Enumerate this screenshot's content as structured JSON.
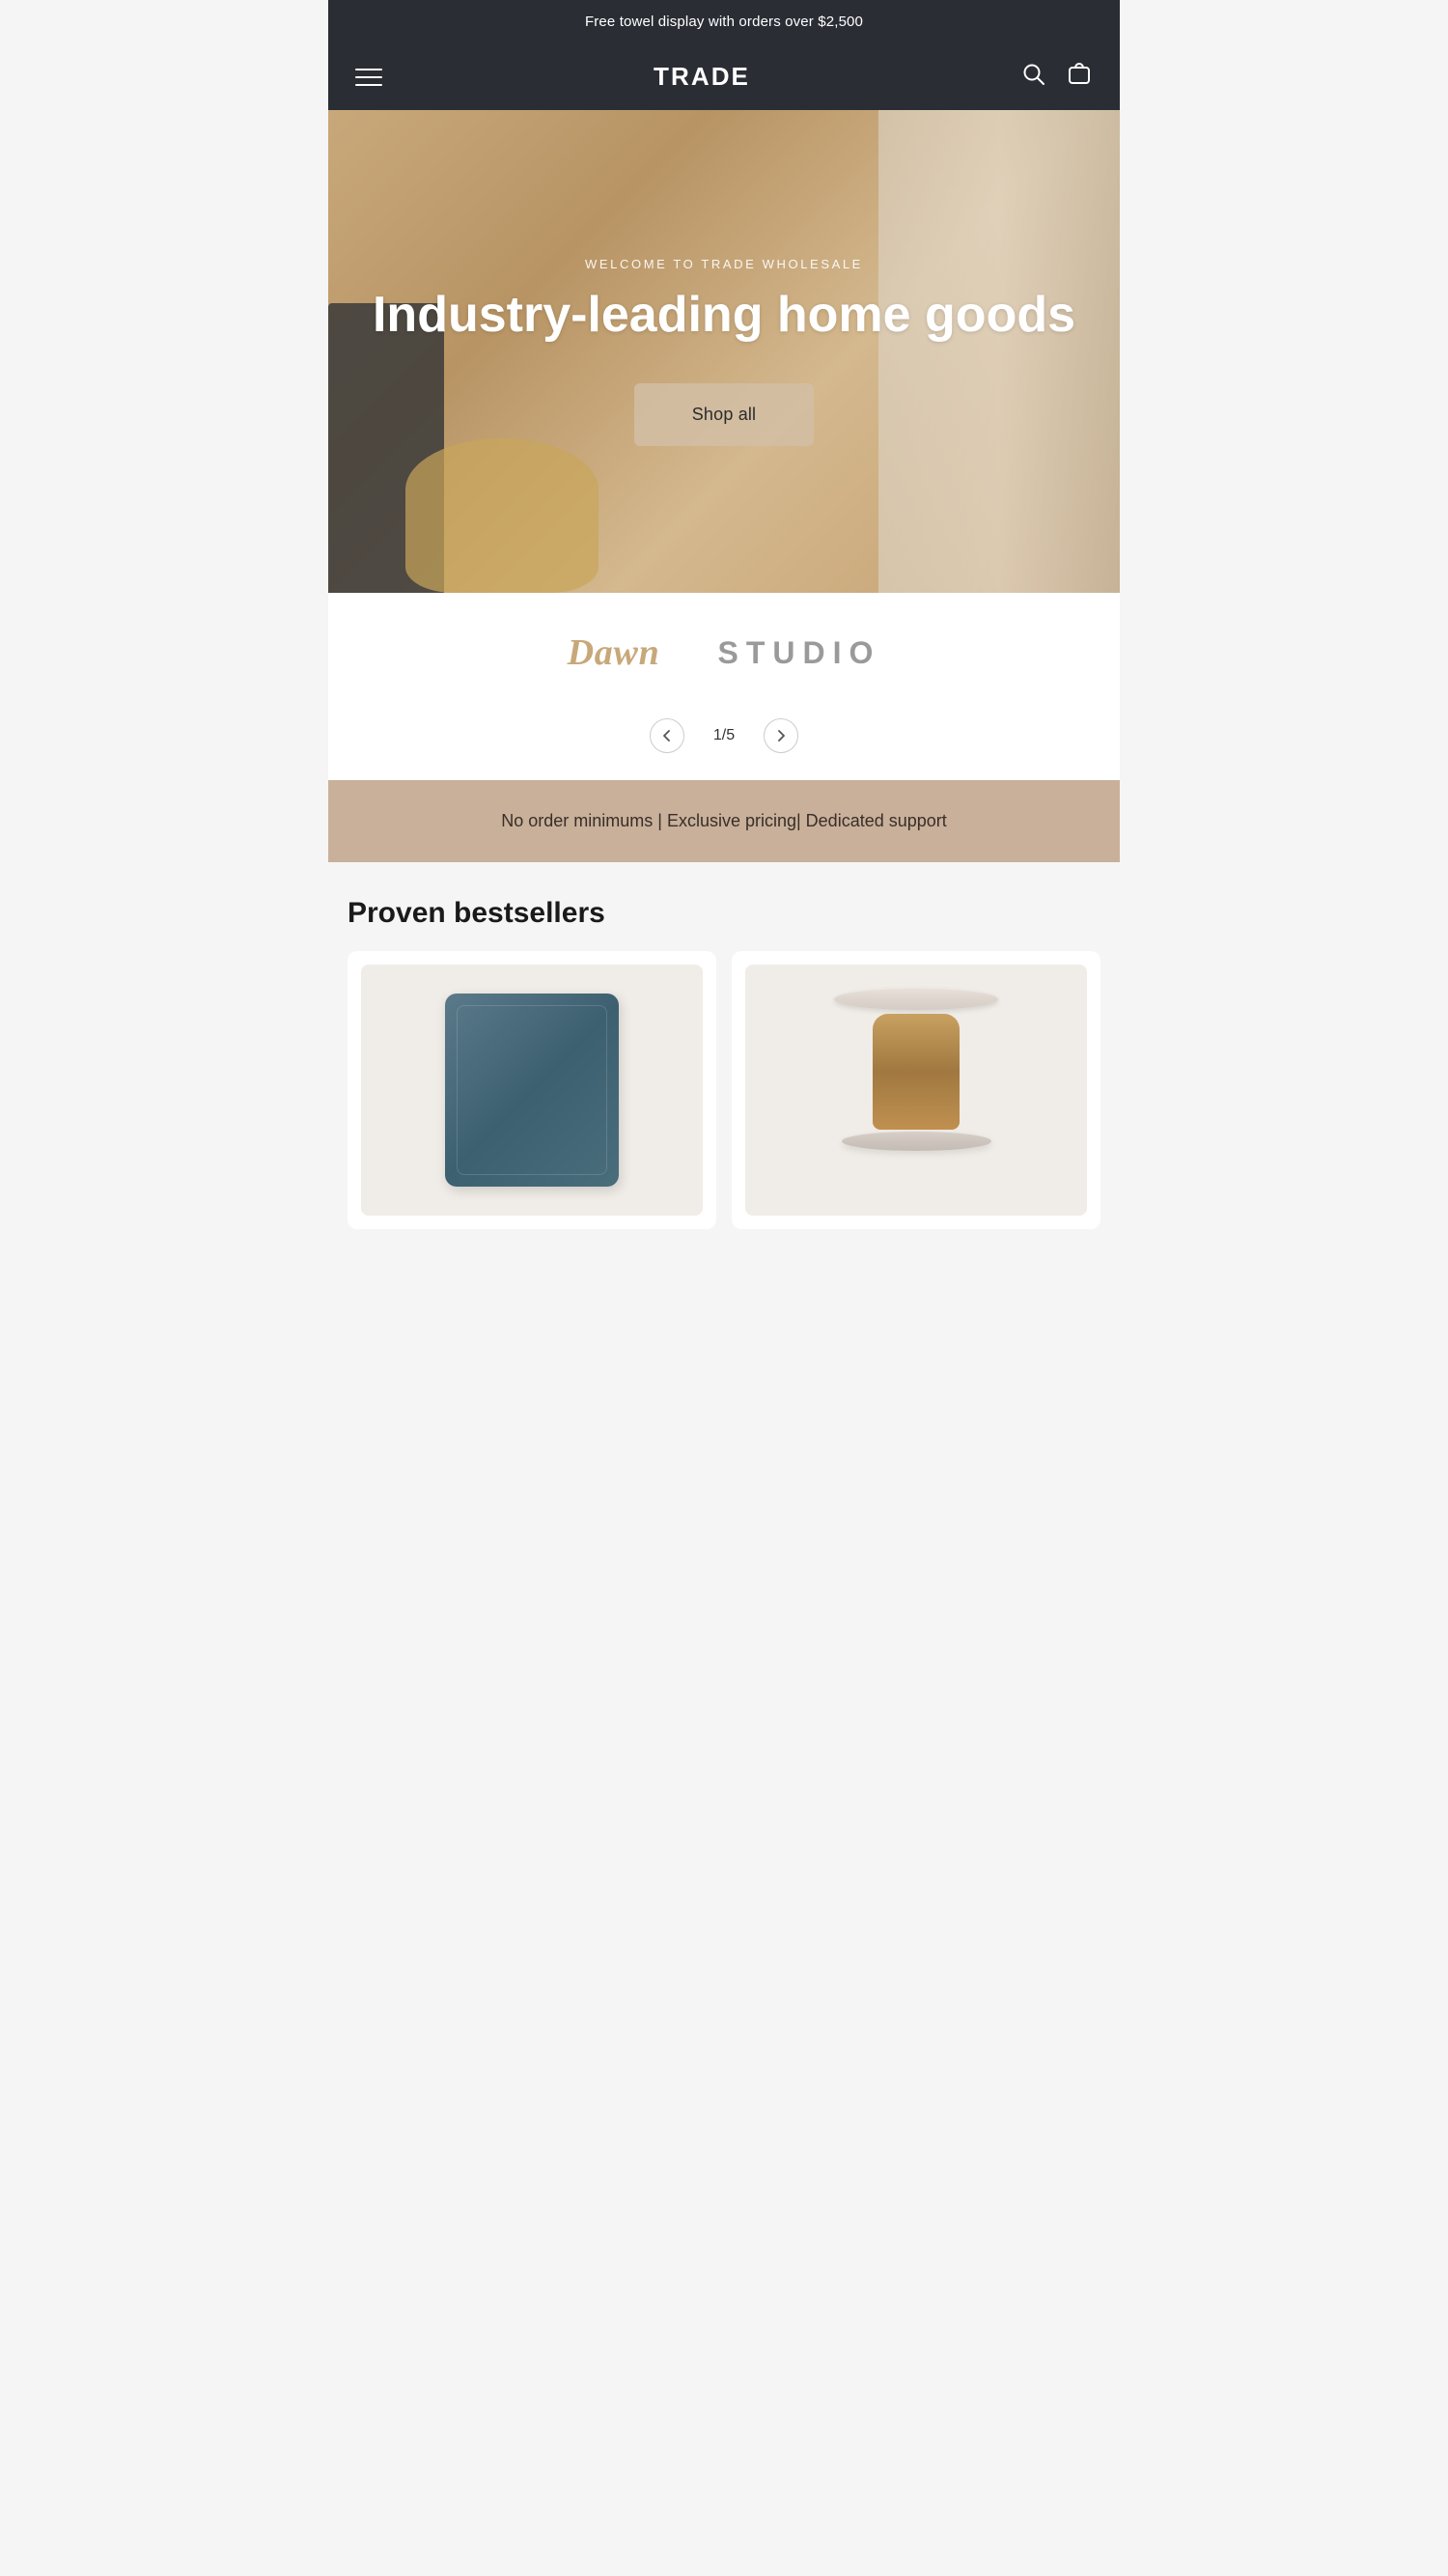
{
  "announcement": {
    "text": "Free towel display with orders over $2,500"
  },
  "header": {
    "logo": "TRADE",
    "menu_icon": "menu-icon",
    "search_icon": "search-icon",
    "cart_icon": "cart-icon"
  },
  "hero": {
    "eyebrow": "WELCOME TO TRADE WHOLESALE",
    "title": "Industry-leading home goods",
    "cta_label": "Shop all"
  },
  "brands": [
    {
      "name": "Dawn",
      "style": "dawn"
    },
    {
      "name": "STUDIO",
      "style": "studio"
    }
  ],
  "pagination": {
    "current": "1",
    "total": "5",
    "display": "1/5",
    "prev_label": "‹",
    "next_label": "›"
  },
  "benefits": {
    "text": "No order minimums | Exclusive pricing| Dedicated support"
  },
  "bestsellers": {
    "title": "Proven bestsellers",
    "products": [
      {
        "id": "product-1",
        "type": "pillow",
        "alt": "Blue pillow"
      },
      {
        "id": "product-2",
        "type": "side-table",
        "alt": "Marble and wood side table"
      }
    ]
  }
}
